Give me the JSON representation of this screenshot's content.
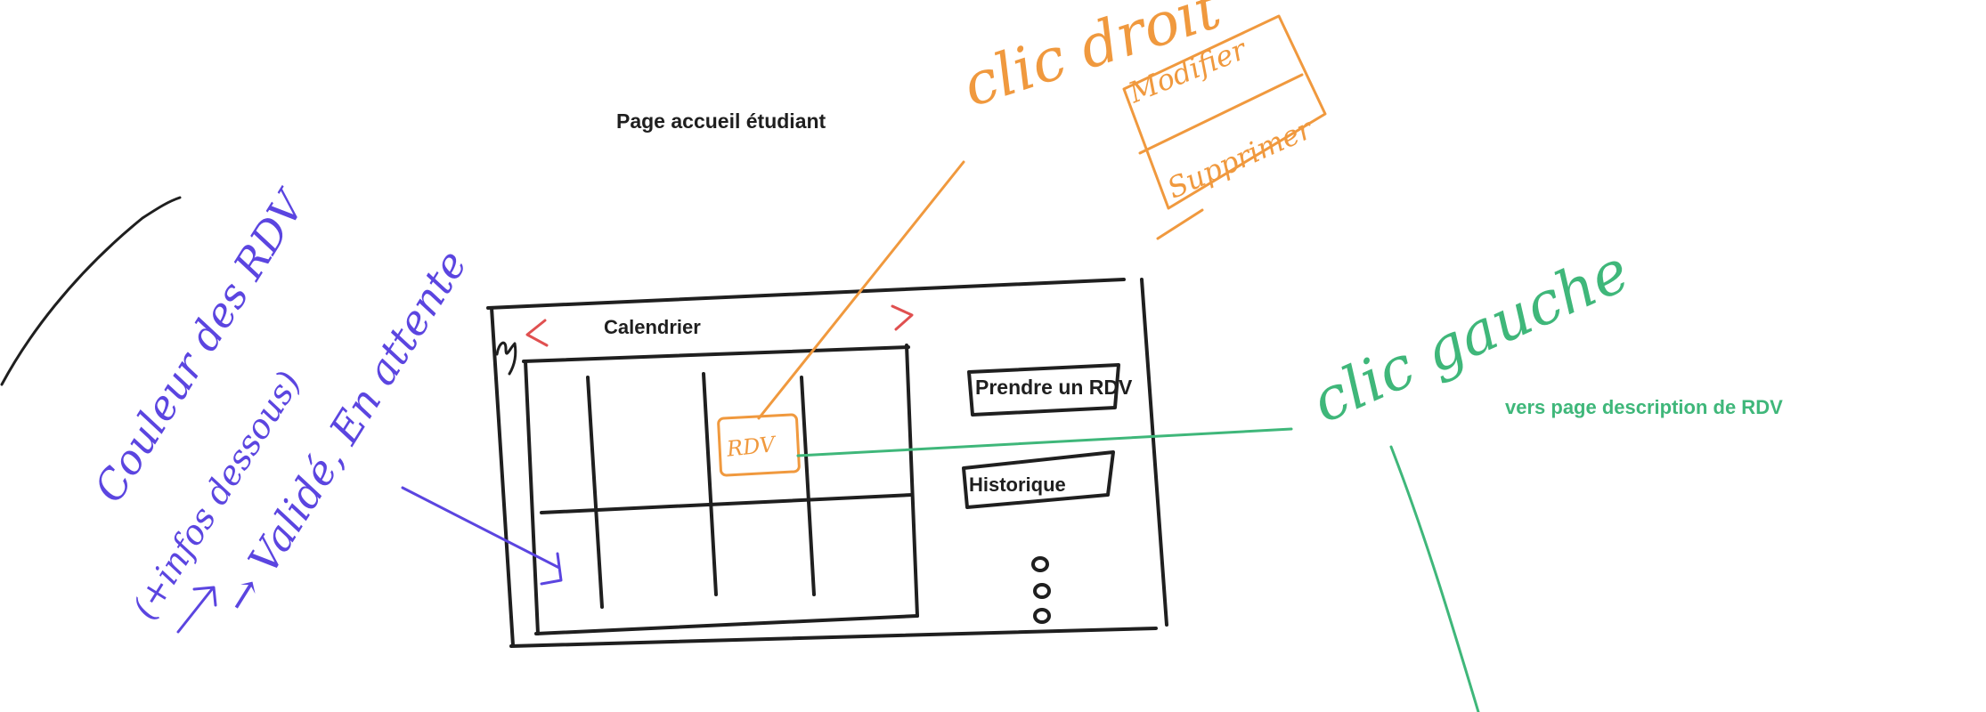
{
  "page_title": "Page accueil étudiant",
  "calendar": {
    "title": "Calendrier",
    "prev_arrow": "<",
    "next_arrow": ">",
    "event_label": "RDV"
  },
  "buttons": {
    "new_appointment": "Prendre un RDV",
    "history": "Historique"
  },
  "annotations": {
    "right_click": "clic droit",
    "right_click_menu": [
      "Modifier",
      "Supprimer"
    ],
    "left_click": "clic gauche",
    "left_click_target": "vers page description de RDV",
    "colors_note": [
      "Couleur des RDV",
      "(+infos dessous)",
      "→ Validé, En attente"
    ]
  },
  "colors": {
    "ink": "#1f1f1f",
    "orange": "#f0993e",
    "green": "#3fb77a",
    "purple": "#5b45e0",
    "red": "#e05050"
  },
  "icons": [
    "more-options-icon"
  ]
}
